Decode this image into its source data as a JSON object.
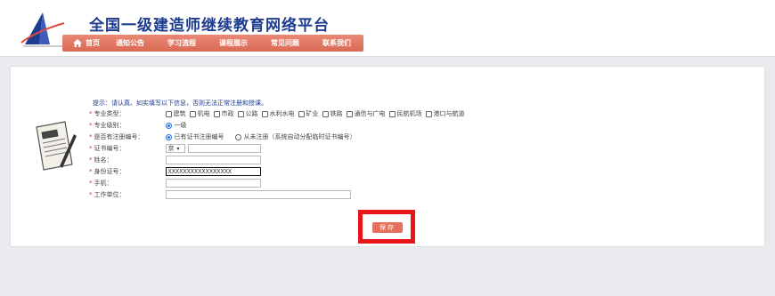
{
  "header": {
    "title": "全国一级建造师继续教育网络平台"
  },
  "nav": {
    "items": [
      "首页",
      "通知公告",
      "学习流程",
      "课程展示",
      "常见问题",
      "联系我们"
    ]
  },
  "form": {
    "hint": "提示：请认真、如实填写以下信息，否则无法正常注册和授课。",
    "major_type": {
      "label": "专业类型：",
      "options": [
        "建筑",
        "机电",
        "市政",
        "公路",
        "水利水电",
        "矿业",
        "铁路",
        "通信与广电",
        "民航机场",
        "港口与航道"
      ]
    },
    "level": {
      "label": "专业级别：",
      "option": "一级"
    },
    "cert_status": {
      "label": "是否有注册编号：",
      "option_yes": "已有证书注册编号",
      "option_no": "从未注册（系统自动分配临时证书编号）"
    },
    "cert_no": {
      "label": "证书编号：",
      "prefix": "京"
    },
    "name": {
      "label": "姓名：",
      "value": ""
    },
    "id_no": {
      "label": "身份证号：",
      "value": "XXXXXXXXXXXXXXXXX"
    },
    "phone": {
      "label": "手机：",
      "value": ""
    },
    "employer": {
      "label": "工作单位：",
      "value": ""
    },
    "save_label": "保存"
  },
  "colors": {
    "accent": "#e46f5c",
    "title": "#1d3b8f",
    "highlight": "#e8141a"
  }
}
